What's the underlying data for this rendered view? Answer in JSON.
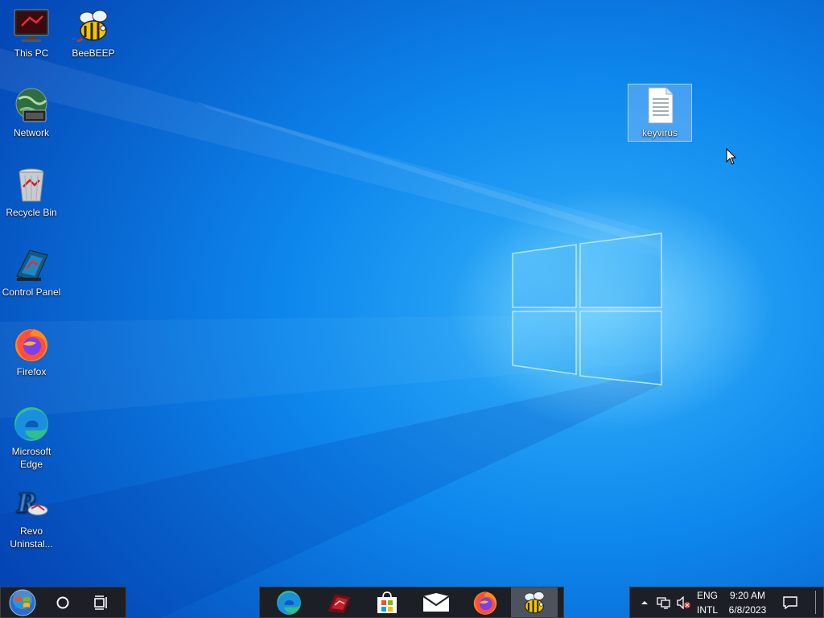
{
  "desktop": {
    "icons": [
      {
        "label": "This PC",
        "icon": "this-pc-icon"
      },
      {
        "label": "BeeBEEP",
        "icon": "beebeep-icon"
      },
      {
        "label": "Network",
        "icon": "network-icon"
      },
      {
        "label": "Recycle Bin",
        "icon": "recycle-bin-icon"
      },
      {
        "label": "Control Panel",
        "icon": "control-panel-icon"
      },
      {
        "label": "Firefox",
        "icon": "firefox-icon"
      },
      {
        "label": "Microsoft Edge",
        "icon": "edge-icon"
      },
      {
        "label": "Revo Uninstal...",
        "icon": "revo-uninstaller-icon"
      },
      {
        "label": "keyvirus",
        "icon": "text-file-icon",
        "selected": true
      }
    ]
  },
  "taskbar": {
    "left": [
      {
        "name": "start-button",
        "icon": "windows-orb-icon"
      },
      {
        "name": "search-button",
        "icon": "circle-search-icon"
      },
      {
        "name": "task-view-button",
        "icon": "task-view-icon"
      }
    ],
    "pinned": [
      {
        "name": "edge",
        "icon": "edge-icon"
      },
      {
        "name": "red-app",
        "icon": "red-app-icon"
      },
      {
        "name": "store",
        "icon": "store-icon"
      },
      {
        "name": "mail",
        "icon": "mail-icon"
      },
      {
        "name": "firefox",
        "icon": "firefox-icon"
      },
      {
        "name": "beebeep",
        "icon": "beebeep-icon",
        "active": true
      }
    ],
    "tray": {
      "language_top": "ENG",
      "language_bottom": "INTL",
      "time": "9:20 AM",
      "date": "6/8/2023",
      "icons": [
        "chevron-up-icon",
        "network-tray-icon",
        "volume-muted-icon",
        "notifications-icon"
      ]
    }
  },
  "colors": {
    "wallpaper_dark": "#0541b4",
    "wallpaper_light": "#2aa7f5",
    "taskbar": "#1c1f26",
    "taskbar_active": "#4d535c"
  }
}
